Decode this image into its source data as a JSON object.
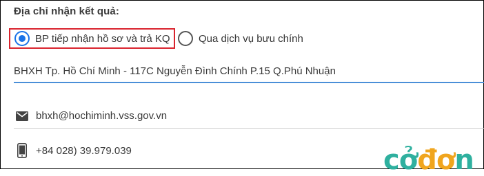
{
  "form": {
    "section_label": "Địa chỉ nhận kết quả:",
    "delivery_options": [
      {
        "label": "BP tiếp nhận hồ sơ và trả KQ",
        "selected": true
      },
      {
        "label": "Qua dịch vụ bưu chính",
        "selected": false
      }
    ],
    "address_value": "BHXH Tp. Hồ Chí Minh - 117C Nguyễn Đình Chính P.15 Q.Phú Nhuận",
    "email_value": "bhxh@hochiminh.vss.gov.vn",
    "phone_value": "+84  028) 39.979.039"
  },
  "icons": {
    "email": "envelope-icon",
    "phone": "mobile-phone-icon"
  },
  "watermark": {
    "part1": "cở",
    "part2": "đơ",
    "part3": "n"
  },
  "colors": {
    "highlight_border": "#d9232d",
    "radio_selected": "#1a73e8",
    "field_underline": "#4a8fd8",
    "watermark_teal": "#2fb09f",
    "watermark_orange": "#f0a51e"
  }
}
